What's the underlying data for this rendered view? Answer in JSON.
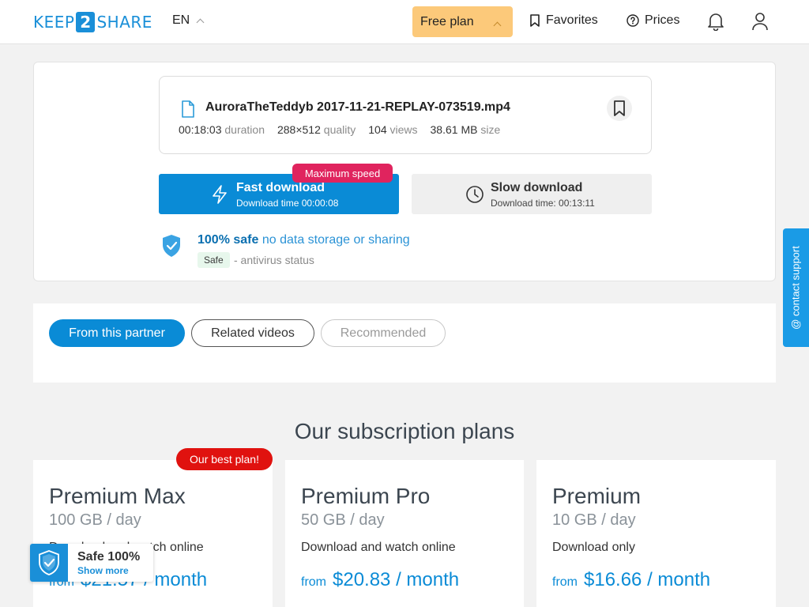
{
  "header": {
    "logo_left": "KEEP",
    "logo_mid": "2",
    "logo_right": "SHARE",
    "language": "EN",
    "free_plan": "Free plan",
    "favorites": "Favorites",
    "prices": "Prices"
  },
  "file": {
    "name": "AuroraTheTeddyb 2017-11-21-REPLAY-073519.mp4",
    "duration_value": "00:18:03",
    "duration_label": "duration",
    "quality_value": "288×512",
    "quality_label": "quality",
    "views_value": "104",
    "views_label": "views",
    "size_value": "38.61 MB",
    "size_label": "size"
  },
  "download": {
    "fast_title": "Fast download",
    "fast_sub": "Download time 00:00:08",
    "max_speed": "Maximum speed",
    "slow_title": "Slow download",
    "slow_sub": "Download time: 00:13:11"
  },
  "safety": {
    "bold": "100% safe",
    "rest": "no data storage or sharing",
    "badge": "Safe",
    "status": "- antivirus status"
  },
  "tabs": [
    {
      "label": "From this partner"
    },
    {
      "label": "Related videos"
    },
    {
      "label": "Recommended"
    }
  ],
  "contact_support": "@ contact support",
  "plans": {
    "title": "Our subscription plans",
    "best_badge": "Our best plan!",
    "items": [
      {
        "name": "Premium Max",
        "quota": "100 GB / day",
        "desc": "Download and watch online",
        "from": "from",
        "price": "$21.57 / month"
      },
      {
        "name": "Premium Pro",
        "quota": "50 GB / day",
        "desc": "Download and watch online",
        "from": "from",
        "price": "$20.83 / month"
      },
      {
        "name": "Premium",
        "quota": "10 GB / day",
        "desc": "Download only",
        "from": "from",
        "price": "$16.66 / month"
      }
    ]
  },
  "safe_widget": {
    "title": "Safe 100%",
    "link": "Show more"
  },
  "colors": {
    "brand": "#1a8fd8",
    "primary": "#0a8bd6",
    "free_plan": "#fcc97a",
    "speed_badge": "#e0245e",
    "best_badge": "#e0120f"
  }
}
